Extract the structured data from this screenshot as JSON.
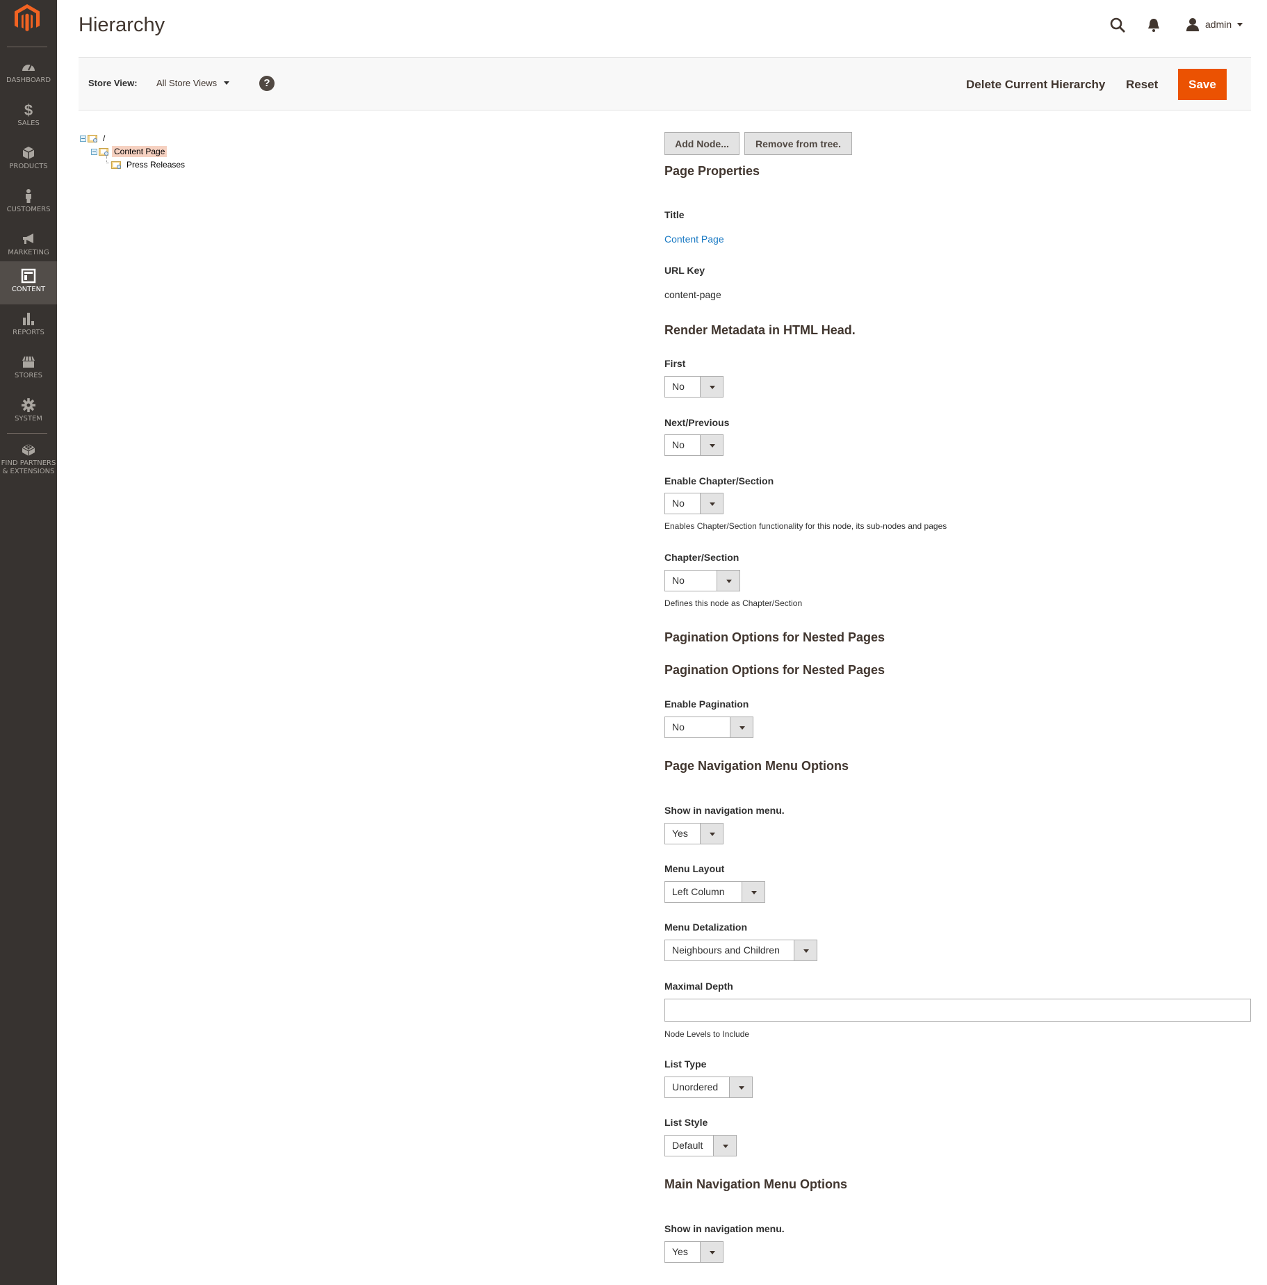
{
  "sidebar": {
    "items": [
      {
        "label": "Dashboard",
        "icon": "dashboard-icon"
      },
      {
        "label": "Sales",
        "icon": "dollar-icon"
      },
      {
        "label": "Products",
        "icon": "box-icon"
      },
      {
        "label": "Customers",
        "icon": "person-icon"
      },
      {
        "label": "Marketing",
        "icon": "megaphone-icon"
      },
      {
        "label": "Content",
        "icon": "layout-icon",
        "active": true
      },
      {
        "label": "Reports",
        "icon": "bar-chart-icon"
      },
      {
        "label": "Stores",
        "icon": "storefront-icon"
      },
      {
        "label": "System",
        "icon": "gear-icon"
      },
      {
        "label": "Find Partners & Extensions",
        "icon": "lego-brick-icon"
      }
    ]
  },
  "header": {
    "title": "Hierarchy",
    "user": "admin"
  },
  "toolbar": {
    "store_view_label": "Store View:",
    "store_view_value": "All Store Views",
    "help": "?",
    "delete_label": "Delete Current Hierarchy",
    "reset_label": "Reset",
    "save_label": "Save"
  },
  "tree": {
    "nodes": [
      {
        "label": "/",
        "level": 0,
        "expanded": true
      },
      {
        "label": "Content Page",
        "level": 1,
        "expanded": true,
        "selected": true
      },
      {
        "label": "Press Releases",
        "level": 2
      }
    ]
  },
  "form": {
    "buttons": {
      "add_node": "Add Node...",
      "remove": "Remove from tree."
    },
    "page_properties": {
      "heading": "Page Properties",
      "title_label": "Title",
      "title_value": "Content Page",
      "url_key_label": "URL Key",
      "url_key_value": "content-page"
    },
    "metadata": {
      "heading": "Render Metadata in HTML Head.",
      "first_label": "First",
      "first_value": "No",
      "next_prev_label": "Next/Previous",
      "next_prev_value": "No",
      "enable_chapter_label": "Enable Chapter/Section",
      "enable_chapter_value": "No",
      "enable_chapter_note": "Enables Chapter/Section functionality for this node, its sub-nodes and pages",
      "chapter_label": "Chapter/Section",
      "chapter_value": "No",
      "chapter_note": "Defines this node as Chapter/Section"
    },
    "pagination": {
      "heading1": "Pagination Options for Nested Pages",
      "heading2": "Pagination Options for Nested Pages",
      "enable_label": "Enable Pagination",
      "enable_value": "No"
    },
    "page_nav": {
      "heading": "Page Navigation Menu Options",
      "show_label": "Show in navigation menu.",
      "show_value": "Yes",
      "layout_label": "Menu Layout",
      "layout_value": "Left Column",
      "detail_label": "Menu Detalization",
      "detail_value": "Neighbours and Children",
      "depth_label": "Maximal Depth",
      "depth_value": "",
      "depth_note": "Node Levels to Include",
      "list_type_label": "List Type",
      "list_type_value": "Unordered",
      "list_style_label": "List Style",
      "list_style_value": "Default"
    },
    "main_nav": {
      "heading": "Main Navigation Menu Options",
      "show_label": "Show in navigation menu.",
      "show_value": "Yes"
    }
  },
  "colors": {
    "sidebar_bg": "#373330",
    "sidebar_active": "#524d49",
    "accent": "#eb5202",
    "link": "#1979c3",
    "tree_selected": "#f6d1c1"
  }
}
